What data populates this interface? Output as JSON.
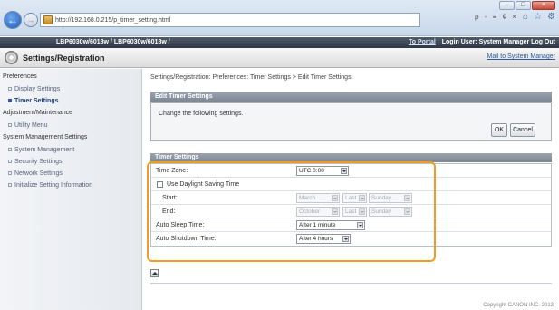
{
  "browser": {
    "url": "http://192.168.0.215/p_timer_setting.html",
    "search_tools": "ρ - ≡ ¢ ×",
    "window_buttons": [
      "–",
      "□",
      "×"
    ]
  },
  "device": {
    "name": "LBP6030w/6018w / LBP6030w/6018w /",
    "portal_link": "To Portal",
    "login_user": "Login User: System Manager Log Out"
  },
  "title": {
    "text": "Settings/Registration",
    "mail_link": "Mail to System Manager"
  },
  "sidebar": {
    "items": [
      {
        "label": "Preferences",
        "type": "head"
      },
      {
        "label": "Display Settings",
        "type": "sub"
      },
      {
        "label": "Timer Settings",
        "type": "sub",
        "active": true
      },
      {
        "label": "Adjustment/Maintenance",
        "type": "head"
      },
      {
        "label": "Utility Menu",
        "type": "sub"
      },
      {
        "label": "System Management Settings",
        "type": "head"
      },
      {
        "label": "System Management",
        "type": "sub"
      },
      {
        "label": "Security Settings",
        "type": "sub"
      },
      {
        "label": "Network Settings",
        "type": "sub"
      },
      {
        "label": "Initialize Setting Information",
        "type": "sub"
      }
    ]
  },
  "main": {
    "breadcrumb": "Settings/Registration: Preferences: Timer Settings > Edit Timer Settings",
    "edit_header": "Edit Timer Settings",
    "edit_note": "Change the following settings.",
    "ok_label": "OK",
    "cancel_label": "Cancel",
    "timer_header": "Timer Settings",
    "time_zone_label": "Time Zone:",
    "time_zone_value": "UTC 0:00",
    "dst_label": "Use Daylight Saving Time",
    "start_label": "Start:",
    "start_month": "March",
    "start_week": "Last",
    "start_day": "Sunday",
    "end_label": "End:",
    "end_month": "October",
    "end_week": "Last",
    "end_day": "Sunday",
    "auto_sleep_label": "Auto Sleep Time:",
    "auto_sleep_value": "After 1 minute",
    "auto_shutdown_label": "Auto Shutdown Time:",
    "auto_shutdown_value": "After 4 hours"
  },
  "footer": {
    "copyright": "Copyright CANON INC. 2013"
  },
  "colors": {
    "highlight": "#f29a26",
    "panel_header": "#8a939e",
    "device_bar": "#3a4250",
    "link": "#2c5a9a"
  }
}
